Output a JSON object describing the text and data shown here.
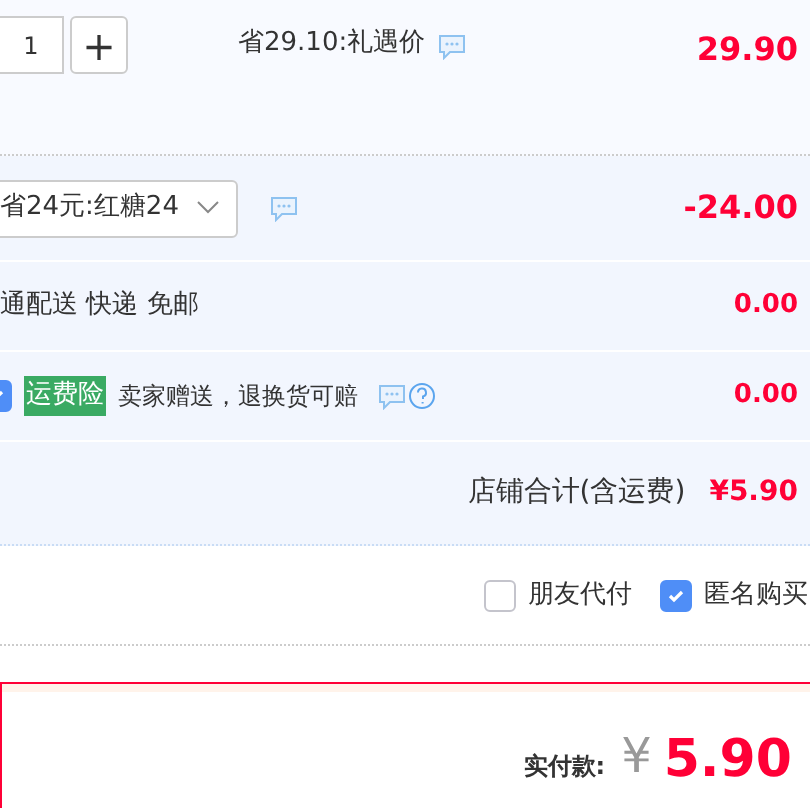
{
  "item": {
    "quantity": "1",
    "plus": "+",
    "discount": "省29.10:礼遇价",
    "price": "29.90"
  },
  "coupon": {
    "value": "省24元:红糖24",
    "amount": "-24.00"
  },
  "shipping": {
    "text": "通配送 快递 免邮",
    "amount": "0.00"
  },
  "insurance": {
    "checked": true,
    "tag": "运费险",
    "text": "卖家赠送，退换货可赔",
    "amount": "0.00"
  },
  "store_total": {
    "label": "店铺合计(含运费)",
    "amount": "¥5.90"
  },
  "options": [
    {
      "label": "朋友代付",
      "checked": false
    },
    {
      "label": "匿名购买",
      "checked": true
    }
  ],
  "payment": {
    "label": "实付款:",
    "currency": "¥",
    "amount": "5.90"
  }
}
